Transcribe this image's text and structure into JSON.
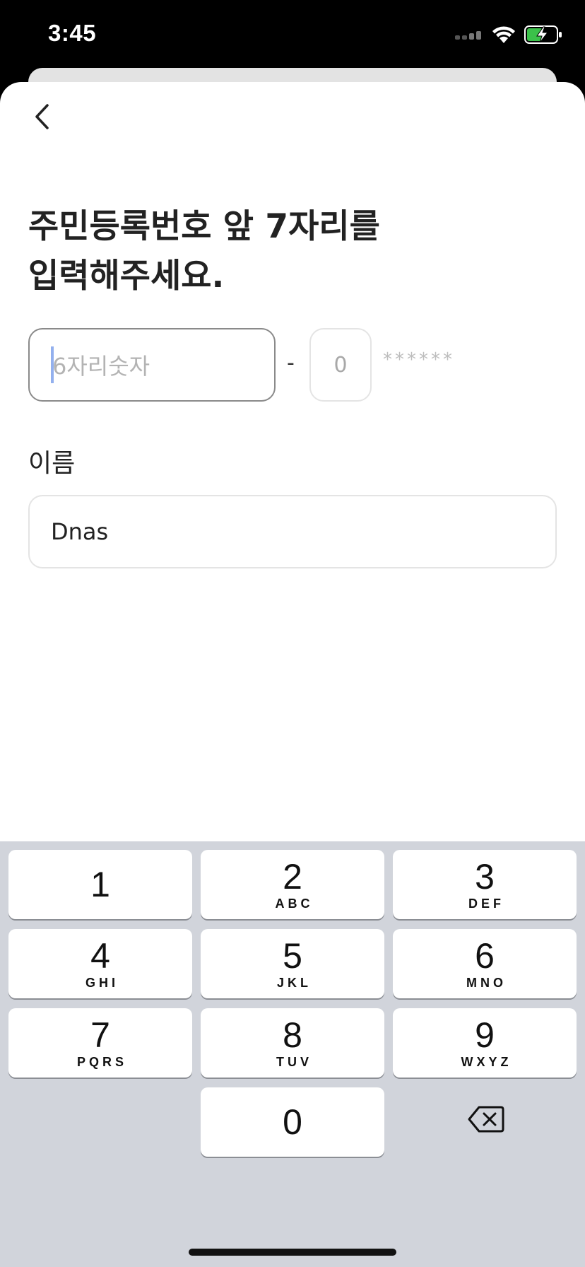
{
  "status_bar": {
    "time": "3:45"
  },
  "form": {
    "title": "주민등록번호 앞 7자리를\n입력해주세요.",
    "id_front_placeholder": "6자리숫자",
    "id_dash": "-",
    "id_back_placeholder": "0",
    "id_mask": "******",
    "name_label": "이름",
    "name_value": "Dnas"
  },
  "keypad": {
    "keys": [
      {
        "num": "1",
        "letters": ""
      },
      {
        "num": "2",
        "letters": "ABC"
      },
      {
        "num": "3",
        "letters": "DEF"
      },
      {
        "num": "4",
        "letters": "GHI"
      },
      {
        "num": "5",
        "letters": "JKL"
      },
      {
        "num": "6",
        "letters": "MNO"
      },
      {
        "num": "7",
        "letters": "PQRS"
      },
      {
        "num": "8",
        "letters": "TUV"
      },
      {
        "num": "9",
        "letters": "WXYZ"
      },
      {
        "num": "0",
        "letters": ""
      }
    ]
  },
  "icons": {
    "back": "chevron-left-icon",
    "delete": "backspace-icon",
    "wifi": "wifi-icon",
    "battery": "battery-charging-icon",
    "signal": "cellular-signal-icon"
  },
  "colors": {
    "battery_fill": "#3bc14a",
    "cursor": "#3b6fe0",
    "keypad_bg": "#d1d4db"
  }
}
